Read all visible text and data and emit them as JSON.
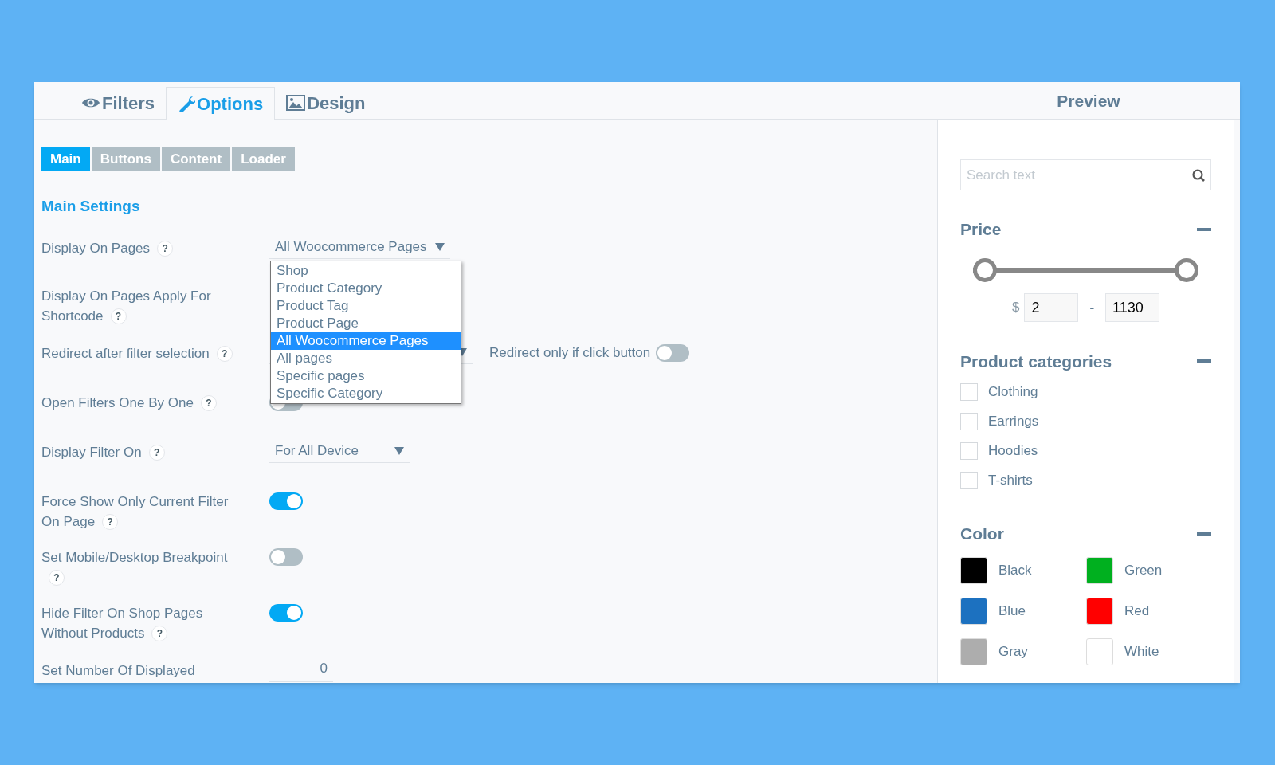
{
  "tabs": [
    {
      "label": "Filters",
      "selected": false
    },
    {
      "label": "Options",
      "selected": true
    },
    {
      "label": "Design",
      "selected": false
    }
  ],
  "preview_title": "Preview",
  "subtabs": [
    {
      "label": "Main",
      "selected": true
    },
    {
      "label": "Buttons",
      "selected": false
    },
    {
      "label": "Content",
      "selected": false
    },
    {
      "label": "Loader",
      "selected": false
    }
  ],
  "section_title": "Main Settings",
  "settings": [
    {
      "label": "Display On Pages",
      "help": "?",
      "kind": "select",
      "value": "All Woocommerce Pages"
    },
    {
      "label": "Display On Pages Apply For Shortcode",
      "help": "?"
    },
    {
      "label": "Redirect after filter selection",
      "help": "?",
      "kind": "select",
      "extra": {
        "label": "Redirect only if click button",
        "on": false
      }
    },
    {
      "label": "Open Filters One By One",
      "help": "?",
      "kind": "toggle",
      "on": false
    },
    {
      "label": "Display Filter On",
      "help": "?",
      "kind": "select",
      "value": "For All Device"
    },
    {
      "label": "Force Show Only Current Filter On Page",
      "help": "?",
      "kind": "toggle",
      "on": true
    },
    {
      "label": "Set Mobile/Desktop Breakpoint",
      "help": "?",
      "kind": "toggle",
      "on": false
    },
    {
      "label": "Hide Filter On Shop Pages Without Products",
      "help": "?",
      "kind": "toggle",
      "on": true
    },
    {
      "label": "Set Number Of Displayed",
      "kind": "number",
      "value": "0"
    }
  ],
  "dropdown": {
    "items": [
      {
        "label": "Shop",
        "selected": false
      },
      {
        "label": "Product Category",
        "selected": false
      },
      {
        "label": "Product Tag",
        "selected": false
      },
      {
        "label": "Product Page",
        "selected": false
      },
      {
        "label": "All Woocommerce Pages",
        "selected": true
      },
      {
        "label": "All pages",
        "selected": false
      },
      {
        "label": "Specific pages",
        "selected": false
      },
      {
        "label": "Specific Category",
        "selected": false
      }
    ]
  },
  "preview": {
    "search": {
      "placeholder": "Search text"
    },
    "price": {
      "title": "Price",
      "thumbs": [
        {
          "level": 0
        },
        {
          "level": 1
        }
      ],
      "currency": "$",
      "min": "2",
      "separator": "-",
      "max": "1130"
    },
    "categories": {
      "title": "Product categories",
      "items": [
        {
          "label": "Clothing",
          "checked": false
        },
        {
          "label": "Earrings",
          "checked": false
        },
        {
          "label": "Hoodies",
          "checked": false
        },
        {
          "label": "T-shirts",
          "checked": false
        }
      ]
    },
    "colors": {
      "title": "Color",
      "items": [
        {
          "label": "Black",
          "color": "#000000"
        },
        {
          "label": "Green",
          "color": "#00b01f"
        },
        {
          "label": "Blue",
          "color": "#1c71c0"
        },
        {
          "label": "Red",
          "color": "#ff0000"
        },
        {
          "label": "Gray",
          "color": "#adadad"
        },
        {
          "label": "White",
          "color": "#ffffff"
        }
      ]
    }
  }
}
